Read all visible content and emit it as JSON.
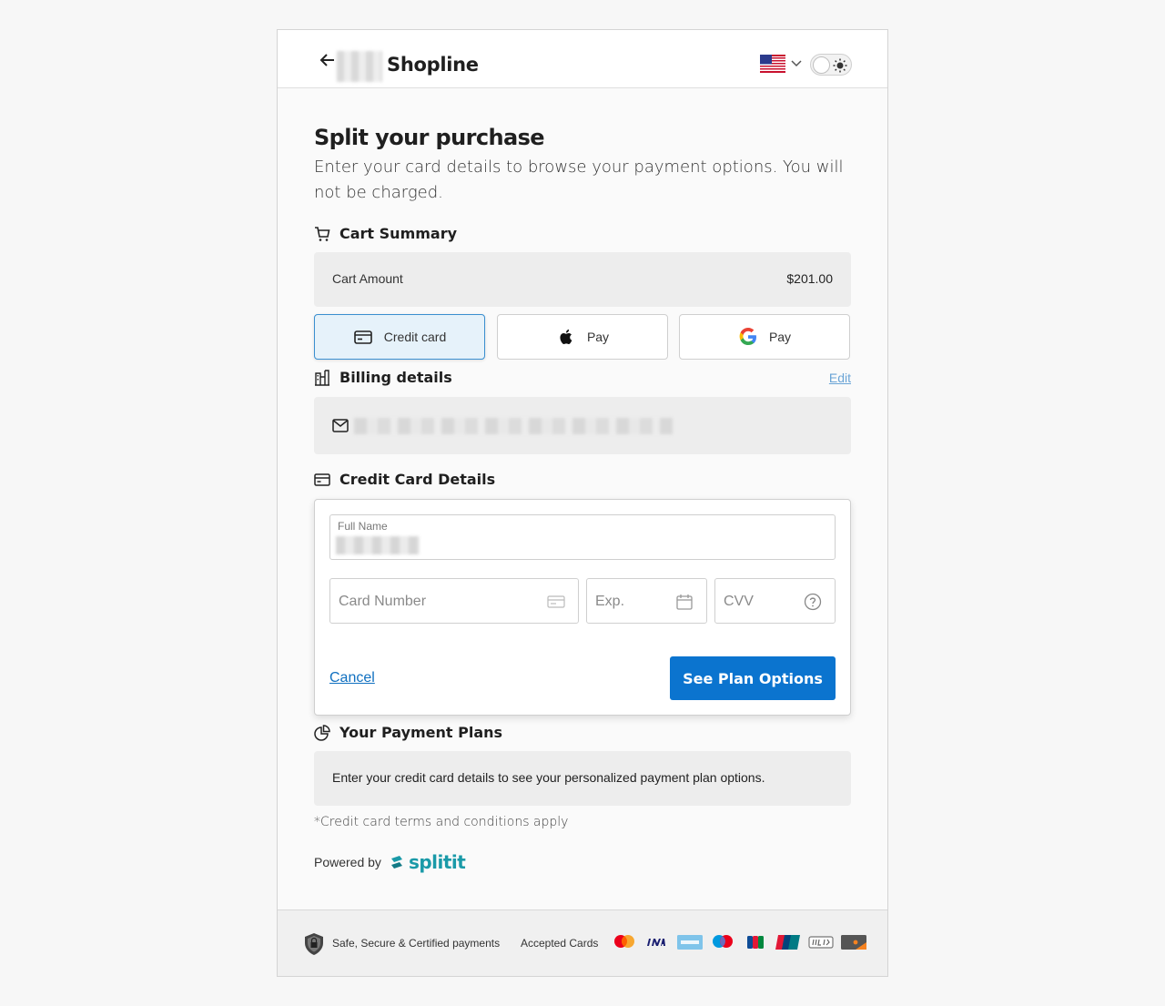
{
  "header": {
    "brand": "Shopline"
  },
  "intro": {
    "title": "Split your purchase",
    "subtitle": "Enter your card details to browse your payment options. You will not be charged."
  },
  "cart": {
    "title": "Cart Summary",
    "amount_label": "Cart Amount",
    "amount_value": "$201.00"
  },
  "payment_methods": {
    "credit_card": "Credit card",
    "apple_pay": "Pay",
    "google_pay": "Pay"
  },
  "billing": {
    "title": "Billing details",
    "edit": "Edit"
  },
  "card_details": {
    "title": "Credit Card Details",
    "full_name_label": "Full Name",
    "card_number_placeholder": "Card Number",
    "exp_placeholder": "Exp.",
    "cvv_placeholder": "CVV",
    "cancel": "Cancel",
    "submit": "See Plan Options"
  },
  "plans": {
    "title": "Your Payment Plans",
    "message": "Enter your credit card details to see your personalized payment plan options."
  },
  "terms": "*Credit card terms and conditions apply",
  "powered": {
    "label": "Powered by",
    "brand": "splitit"
  },
  "footer": {
    "secure": "Safe, Secure & Certified payments",
    "accepted": "Accepted Cards",
    "card_icons": [
      "mastercard-icon",
      "visa-icon",
      "amex-icon",
      "maestro-icon",
      "jcb-icon",
      "unionpay-icon",
      "upi-icon",
      "discover-icon"
    ]
  },
  "colors": {
    "primary": "#0b74cf",
    "link": "#1070c0",
    "active_tab_bg": "#e6f2fa",
    "splitit": "#1a9aa8"
  }
}
